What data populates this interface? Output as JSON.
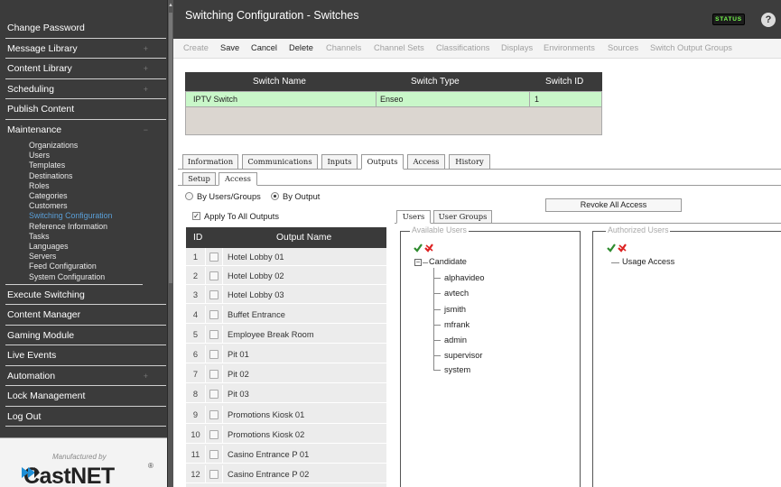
{
  "sidebar": {
    "items": [
      {
        "label": "Change Password",
        "expandable": false
      },
      {
        "label": "Message Library",
        "expandable": true
      },
      {
        "label": "Content Library",
        "expandable": true
      },
      {
        "label": "Scheduling",
        "expandable": true
      },
      {
        "label": "Publish Content",
        "expandable": false
      },
      {
        "label": "Maintenance",
        "expandable": true
      }
    ],
    "maintenance_sub": [
      "Organizations",
      "Users",
      "Templates",
      "Destinations",
      "Roles",
      "Categories",
      "Customers",
      "Switching Configuration",
      "Reference Information",
      "Tasks",
      "Languages",
      "Servers",
      "Feed Configuration",
      "System Configuration"
    ],
    "active_sub": "Switching Configuration",
    "items_after": [
      {
        "label": "Execute Switching",
        "expandable": false
      },
      {
        "label": "Content Manager",
        "expandable": false
      },
      {
        "label": "Gaming Module",
        "expandable": false
      },
      {
        "label": "Live Events",
        "expandable": false
      },
      {
        "label": "Automation",
        "expandable": true
      },
      {
        "label": "Lock Management",
        "expandable": false
      },
      {
        "label": "Log Out",
        "expandable": false
      }
    ],
    "brand_manufactured": "Manufactured by",
    "brand_name": "CastNET",
    "brand_reg": "®"
  },
  "header": {
    "title": "Switching Configuration - Switches",
    "status_label": "STATUS",
    "help_label": "?"
  },
  "toolbar": {
    "create": "Create",
    "save": "Save",
    "cancel": "Cancel",
    "delete": "Delete",
    "channels": "Channels",
    "channel_sets": "Channel Sets",
    "classifications": "Classifications",
    "displays": "Displays",
    "environments": "Environments",
    "sources": "Sources",
    "switch_output_groups": "Switch Output Groups"
  },
  "grid": {
    "col_name": "Switch Name",
    "col_type": "Switch Type",
    "col_id": "Switch ID",
    "row": {
      "name": "IPTV Switch",
      "type": "Enseo",
      "id": "1"
    }
  },
  "tabs": {
    "information": "Information",
    "communications": "Communications",
    "inputs": "Inputs",
    "outputs": "Outputs",
    "access": "Access",
    "history": "History"
  },
  "subtabs": {
    "setup": "Setup",
    "access": "Access"
  },
  "access": {
    "by_users_groups": "By Users/Groups",
    "by_output": "By Output",
    "apply_all": "Apply To All Outputs",
    "revoke": "Revoke All Access",
    "users_tab": "Users",
    "user_groups_tab": "User Groups",
    "available_users": "Available Users",
    "authorized_users": "Authorized Users",
    "candidate": "Candidate",
    "users": [
      "alphavideo",
      "avtech",
      "jsmith",
      "mfrank",
      "admin",
      "supervisor",
      "system"
    ],
    "usage_access": "Usage Access"
  },
  "outputs": {
    "col_id": "ID",
    "col_name": "Output Name",
    "rows": [
      {
        "id": "1",
        "name": "Hotel Lobby 01"
      },
      {
        "id": "2",
        "name": "Hotel Lobby 02"
      },
      {
        "id": "3",
        "name": "Hotel Lobby 03"
      },
      {
        "id": "4",
        "name": "Buffet Entrance"
      },
      {
        "id": "5",
        "name": "Employee Break Room"
      },
      {
        "id": "6",
        "name": "Pit 01"
      },
      {
        "id": "7",
        "name": "Pit 02"
      },
      {
        "id": "8",
        "name": "Pit 03"
      },
      {
        "id": "9",
        "name": "Promotions Kiosk 01"
      },
      {
        "id": "10",
        "name": "Promotions Kiosk 02"
      },
      {
        "id": "11",
        "name": "Casino Entrance P 01"
      },
      {
        "id": "12",
        "name": "Casino Entrance P 02"
      }
    ]
  },
  "colors": {
    "selected_row": "#c9f7c9",
    "active_link": "#5a9fd8",
    "status_text": "#78ff50"
  }
}
